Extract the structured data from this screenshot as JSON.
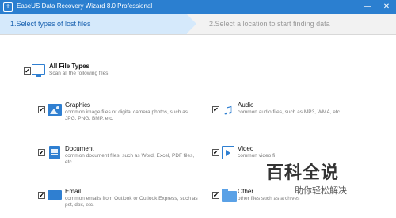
{
  "window": {
    "title": "EaseUS Data Recovery Wizard 8.0 Professional",
    "app_icon": "plus-square-icon",
    "minimize_label": "—",
    "close_label": "✕"
  },
  "steps": {
    "step1": "1.Select types of lost files",
    "step2": "2.Select a location to start finding data"
  },
  "colors": {
    "titlebar": "#2b7fd0",
    "accent": "#2f7fd1",
    "active_step": "#d5e9fb"
  },
  "all_types": {
    "checked": true,
    "check_mark": "✔",
    "title": "All File Types",
    "desc": "Scan all the following files",
    "icon": "monitor-icon"
  },
  "types": {
    "graphics": {
      "checked": true,
      "title": "Graphics",
      "desc1": "common image files or digital camera photos, such as",
      "desc2": "JPG, PNG, BMP, etc.",
      "icon": "image-icon"
    },
    "audio": {
      "checked": true,
      "title": "Audio",
      "desc1": "common audio files, such as MP3, WMA, etc.",
      "icon": "music-note-icon",
      "glyph": "♫"
    },
    "document": {
      "checked": true,
      "title": "Document",
      "desc1": "common document files, such as Word, Excel, PDF files,",
      "desc2": "etc.",
      "icon": "document-icon"
    },
    "video": {
      "checked": true,
      "title": "Video",
      "desc1": "common video fi",
      "icon": "video-icon"
    },
    "email": {
      "checked": true,
      "title": "Email",
      "desc1": "common emails from Outlook or Outlook Express, such as",
      "desc2": "pst, dbx, etc.",
      "icon": "envelope-icon"
    },
    "other": {
      "checked": true,
      "title": "Other",
      "desc1": "other files such as archives",
      "icon": "folder-icon"
    }
  },
  "watermark": {
    "main": "百科全说",
    "sub": "助你轻松解决"
  }
}
